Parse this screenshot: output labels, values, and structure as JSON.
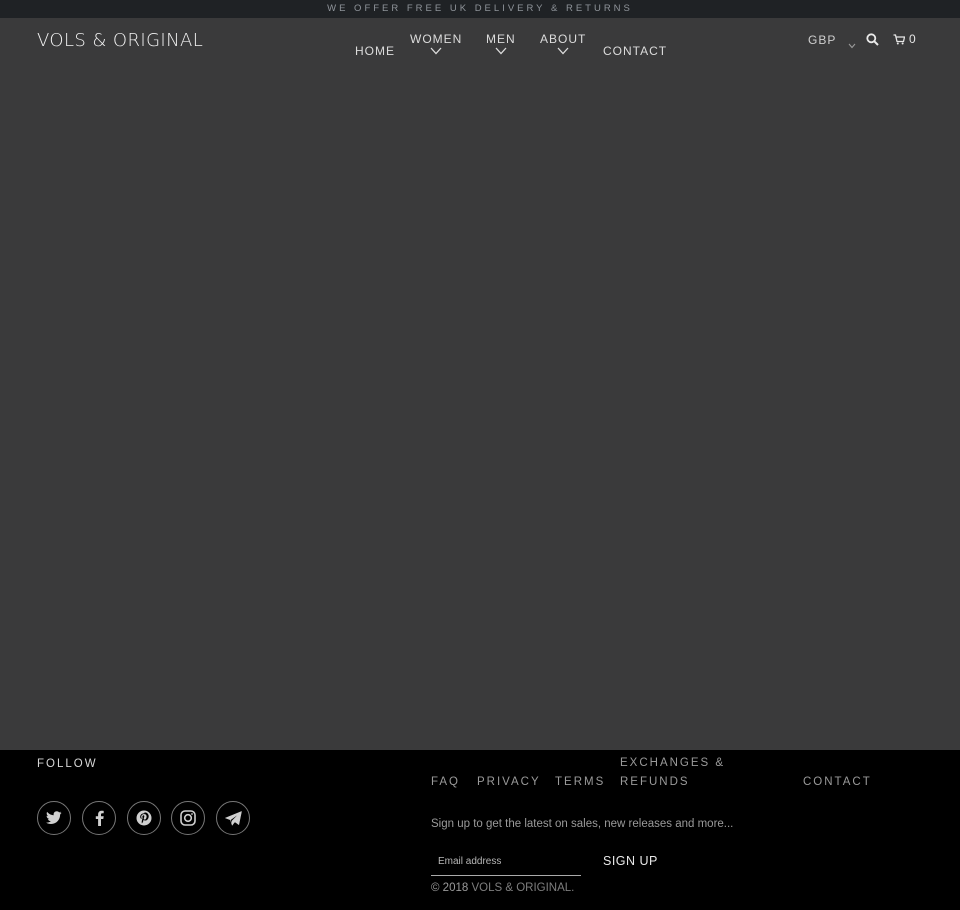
{
  "announcement": "WE OFFER FREE UK DELIVERY & RETURNS",
  "header": {
    "logo": "VOLS & ORIGINAL",
    "nav": [
      {
        "label": "HOME",
        "has_dropdown": false
      },
      {
        "label": "WOMEN",
        "has_dropdown": true
      },
      {
        "label": "MEN",
        "has_dropdown": true
      },
      {
        "label": "ABOUT",
        "has_dropdown": true
      },
      {
        "label": "CONTACT",
        "has_dropdown": false
      }
    ],
    "currency": "GBP",
    "cart_count": "0",
    "icons": {
      "search": "search-icon",
      "cart": "cart-icon",
      "dropdown": "chevron-down-icon"
    }
  },
  "footer": {
    "follow_title": "FOLLOW",
    "social": [
      "twitter-icon",
      "facebook-icon",
      "pinterest-icon",
      "instagram-icon",
      "telegram-icon"
    ],
    "links": {
      "faq": "FAQ",
      "privacy": "PRIVACY",
      "terms": "TERMS",
      "exchanges_line1": "EXCHANGES &",
      "exchanges_line2": "REFUNDS",
      "contact": "CONTACT"
    },
    "signup_text": "Sign up to get the latest on sales, new releases and more...",
    "email_placeholder": "Email address",
    "signup_button": "SIGN UP",
    "copyright_prefix": "© 2018",
    "copyright_brand": "VOLS & ORIGINAL."
  },
  "colors": {
    "page_bg": "#3a3a3b",
    "announcement_bg": "#1f2225",
    "footer_bg": "#000000"
  }
}
